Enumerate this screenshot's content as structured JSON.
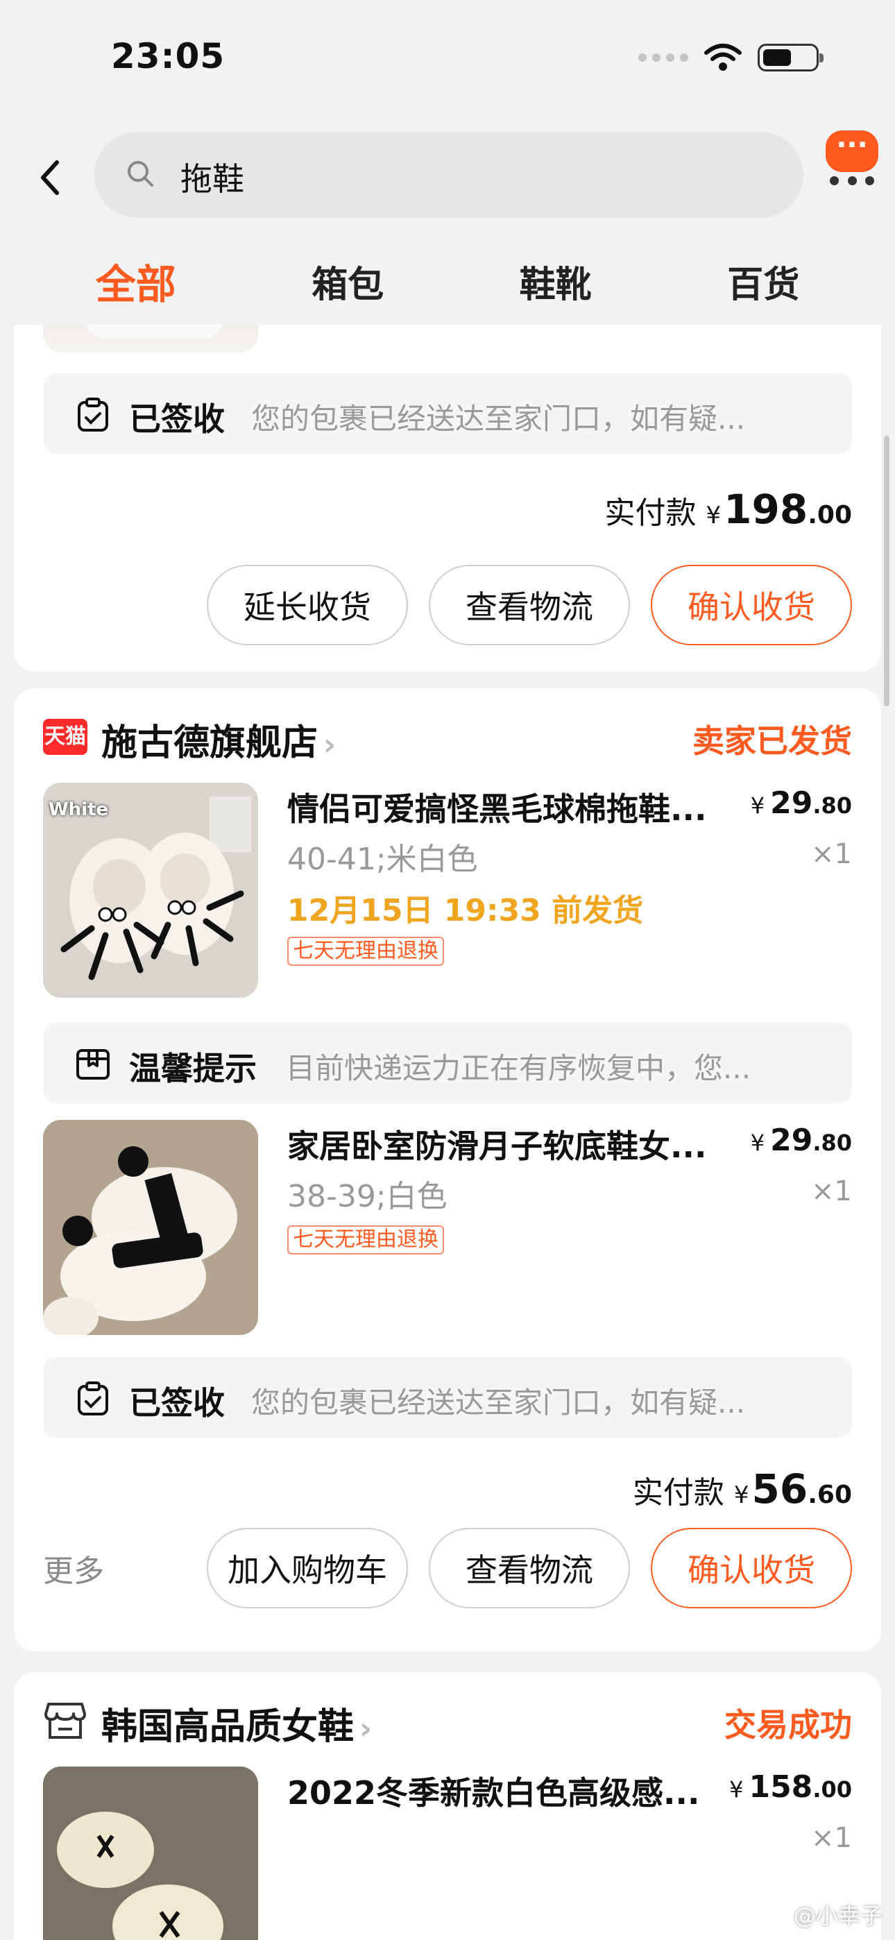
{
  "status_bar": {
    "time": "23:05"
  },
  "search": {
    "query": "拖鞋"
  },
  "tabs": [
    "全部",
    "箱包",
    "鞋靴",
    "百货"
  ],
  "orders": [
    {
      "delivery_label": "已签收",
      "delivery_text": "您的包裹已经送达至家门口，如有疑...",
      "paid_label": "实付款",
      "paid_currency": "¥",
      "paid_int": "198",
      "paid_dec": ".00",
      "buttons": [
        "延长收货",
        "查看物流",
        "确认收货"
      ]
    },
    {
      "shop_logo": "天猫",
      "shop_name": "施古德旗舰店",
      "status": "卖家已发货",
      "items": [
        {
          "title": "情侣可爱搞怪黑毛球棉拖鞋...",
          "spec": "40-41;米白色",
          "ship": "12月15日 19:33 前发货",
          "tag": "七天无理由退换",
          "price_int": "29",
          "price_dec": ".80",
          "qty": "×1",
          "image_label": "White"
        },
        {
          "title": "家居卧室防滑月子软底鞋女...",
          "spec": "38-39;白色",
          "tag": "七天无理由退换",
          "price_int": "29",
          "price_dec": ".80",
          "qty": "×1"
        }
      ],
      "notice_label": "温馨提示",
      "notice_text": "目前快递运力正在有序恢复中，您...",
      "delivery_label": "已签收",
      "delivery_text": "您的包裹已经送达至家门口，如有疑...",
      "paid_label": "实付款",
      "paid_currency": "¥",
      "paid_int": "56",
      "paid_dec": ".60",
      "more": "更多",
      "buttons": [
        "加入购物车",
        "查看物流",
        "确认收货"
      ]
    },
    {
      "shop_name": "韩国高品质女鞋",
      "status": "交易成功",
      "items": [
        {
          "title": "2022冬季新款白色高级感...",
          "price_int": "158",
          "price_dec": ".00",
          "qty": "×1"
        }
      ]
    }
  ],
  "currency": "¥",
  "watermark": "@小幸子",
  "colors": {
    "accent": "#ff5a1f",
    "ship": "#f0a520",
    "tmall": "#ff2b2b"
  }
}
